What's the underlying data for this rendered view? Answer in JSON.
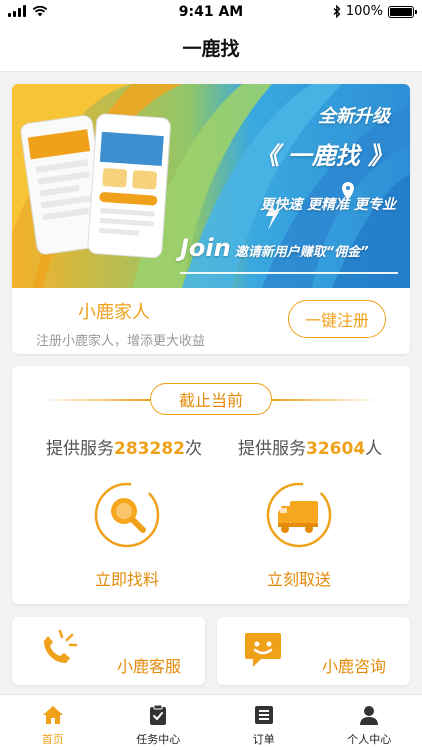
{
  "status_bar": {
    "time": "9:41 AM",
    "battery": "100%",
    "battery_level": 1.0
  },
  "nav": {
    "title": "一鹿找"
  },
  "banner": {
    "upgrade": "全新升级",
    "brand": "《 一鹿找 》",
    "features": "更快速  更精准  更专业",
    "join_word": "Join",
    "join_text": "邀请新用户赚取“佣金”"
  },
  "register": {
    "title": "小鹿家人",
    "subtitle": "注册小鹿家人，增添更大收益",
    "button_label": "一键注册"
  },
  "stats": {
    "deadline_label": "截止当前",
    "service_prefix": "提供服务",
    "service_count": "283282",
    "service_unit": "次",
    "people_prefix": "提供服务",
    "people_count": "32604",
    "people_unit": "人",
    "find_label": "立即找料",
    "pickup_label": "立刻取送"
  },
  "features": {
    "service_label": "小鹿客服",
    "consult_label": "小鹿咨询"
  },
  "tabs": [
    {
      "label": "首页",
      "icon": "home-icon",
      "active": true
    },
    {
      "label": "任务中心",
      "icon": "clipboard-icon",
      "active": false
    },
    {
      "label": "订单",
      "icon": "list-icon",
      "active": false
    },
    {
      "label": "个人中心",
      "icon": "person-icon",
      "active": false
    }
  ],
  "colors": {
    "accent": "#f0a11a",
    "accent_dark": "#e48b0a",
    "inactive_icon": "#333333"
  }
}
